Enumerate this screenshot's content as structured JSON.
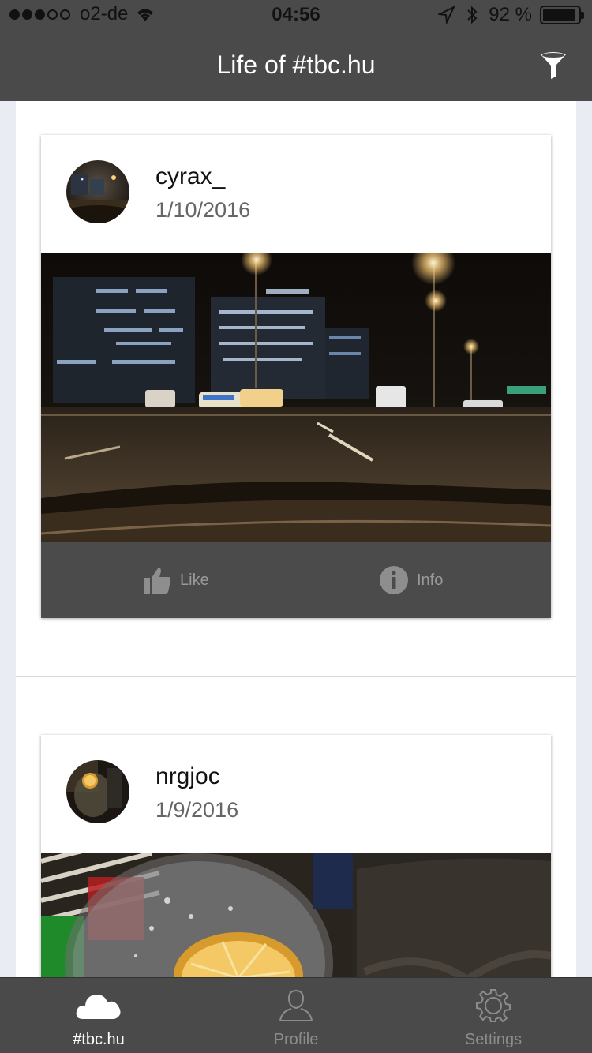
{
  "status_bar": {
    "carrier": "o2-de",
    "time": "04:56",
    "battery": "92 %",
    "battery_level": 0.92,
    "signal_bars_filled": 3,
    "signal_bars_total": 5
  },
  "nav": {
    "title": "Life of #tbc.hu",
    "filter_icon": "filter-icon"
  },
  "feed": {
    "posts": [
      {
        "username": "cyrax_",
        "date": "1/10/2016",
        "like_label": "Like",
        "info_label": "Info"
      },
      {
        "username": "nrgjoc",
        "date": "1/9/2016"
      }
    ]
  },
  "tabbar": {
    "tabs": [
      {
        "label": "#tbc.hu",
        "icon": "cloud-icon",
        "active": true
      },
      {
        "label": "Profile",
        "icon": "person-icon",
        "active": false
      },
      {
        "label": "Settings",
        "icon": "gear-icon",
        "active": false
      }
    ]
  },
  "colors": {
    "header_bg": "#4a4a4a",
    "tab_active": "#ffffff",
    "tab_inactive": "#8c8c8c",
    "action_bar_bg": "#4b4b4b"
  }
}
